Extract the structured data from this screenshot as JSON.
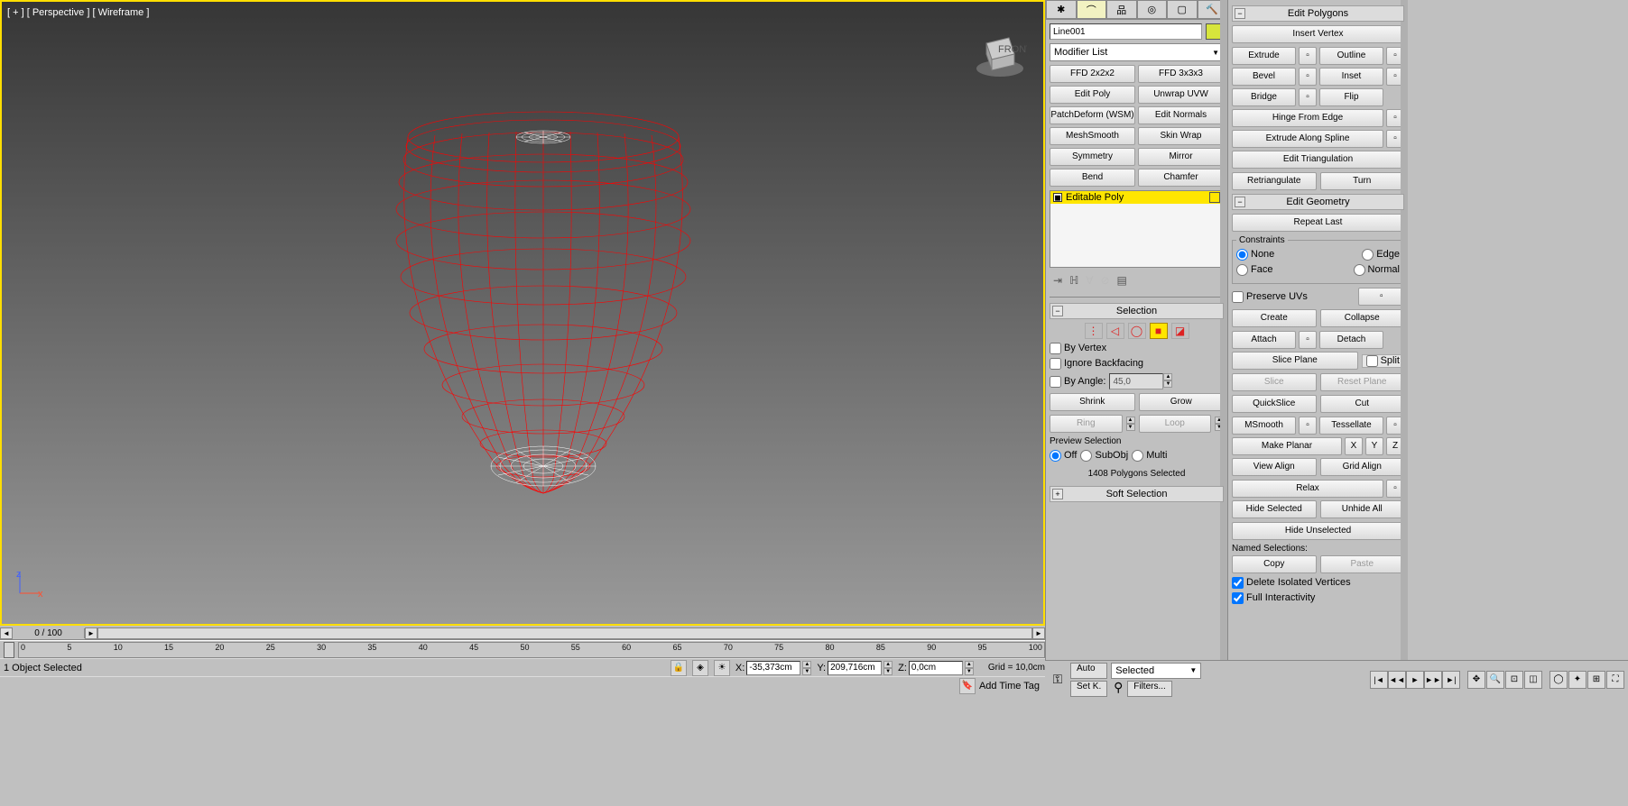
{
  "viewport": {
    "label": "[ + ] [ Perspective ] [ Wireframe ]"
  },
  "axis": {
    "x": "x",
    "y": "y",
    "z": "z"
  },
  "timeline": {
    "position": "0 / 100",
    "marks": [
      "0",
      "5",
      "10",
      "15",
      "20",
      "25",
      "30",
      "35",
      "40",
      "45",
      "50",
      "55",
      "60",
      "65",
      "70",
      "75",
      "80",
      "85",
      "90",
      "95",
      "100"
    ]
  },
  "status": {
    "selected": "1 Object Selected",
    "x_label": "X:",
    "x_val": "-35,373cm",
    "y_label": "Y:",
    "y_val": "209,716cm",
    "z_label": "Z:",
    "z_val": "0,0cm",
    "grid": "Grid = 10,0cm",
    "addtag": "Add Time Tag"
  },
  "cmd": {
    "obj_name": "Line001",
    "modifier_list": "Modifier List",
    "presets": [
      "FFD 2x2x2",
      "FFD 3x3x3",
      "Edit Poly",
      "Unwrap UVW",
      "PatchDeform (WSM)",
      "Edit Normals",
      "MeshSmooth",
      "Skin Wrap",
      "Symmetry",
      "Mirror",
      "Bend",
      "Chamfer"
    ],
    "stack_item": "Editable Poly",
    "selection_title": "Selection",
    "by_vertex": "By Vertex",
    "ignore_bf": "Ignore Backfacing",
    "by_angle": "By Angle:",
    "angle_val": "45,0",
    "shrink": "Shrink",
    "grow": "Grow",
    "ring": "Ring",
    "loop": "Loop",
    "preview": "Preview Selection",
    "off": "Off",
    "subobj": "SubObj",
    "multi": "Multi",
    "polycount": "1408 Polygons Selected",
    "softsel": "Soft Selection"
  },
  "edit": {
    "polygons_title": "Edit Polygons",
    "insert_vertex": "Insert Vertex",
    "extrude": "Extrude",
    "outline": "Outline",
    "bevel": "Bevel",
    "inset": "Inset",
    "bridge": "Bridge",
    "flip": "Flip",
    "hinge": "Hinge From Edge",
    "extspline": "Extrude Along Spline",
    "edittri": "Edit Triangulation",
    "retri": "Retriangulate",
    "turn": "Turn",
    "geom_title": "Edit Geometry",
    "repeat": "Repeat Last",
    "constraints": "Constraints",
    "none": "None",
    "edge": "Edge",
    "face": "Face",
    "normal": "Normal",
    "preserve": "Preserve UVs",
    "create": "Create",
    "collapse": "Collapse",
    "attach": "Attach",
    "detach": "Detach",
    "sliceplane": "Slice Plane",
    "split": "Split",
    "slice": "Slice",
    "resetplane": "Reset Plane",
    "quickslice": "QuickSlice",
    "cut": "Cut",
    "msmooth": "MSmooth",
    "tessellate": "Tessellate",
    "makeplanar": "Make Planar",
    "x": "X",
    "y": "Y",
    "z": "Z",
    "viewalign": "View Align",
    "gridalign": "Grid Align",
    "relax": "Relax",
    "hidesel": "Hide Selected",
    "unhideall": "Unhide All",
    "hideunsel": "Hide Unselected",
    "namedsel": "Named Selections:",
    "copy": "Copy",
    "paste": "Paste",
    "delvert": "Delete Isolated Vertices",
    "fullint": "Full Interactivity"
  },
  "controls": {
    "auto": "Auto",
    "selected": "Selected",
    "setk": "Set K.",
    "filters": "Filters..."
  }
}
